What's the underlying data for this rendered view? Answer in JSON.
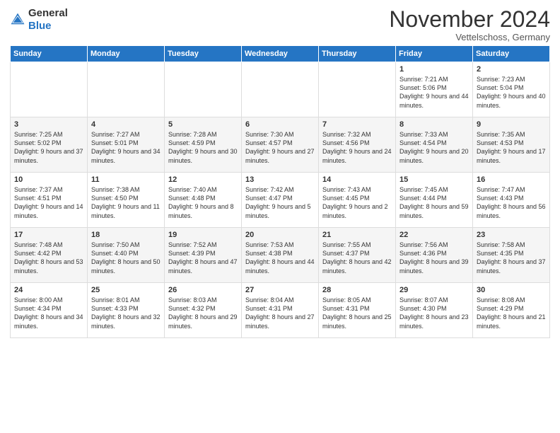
{
  "header": {
    "logo_general": "General",
    "logo_blue": "Blue",
    "month_title": "November 2024",
    "location": "Vettelschoss, Germany"
  },
  "weekdays": [
    "Sunday",
    "Monday",
    "Tuesday",
    "Wednesday",
    "Thursday",
    "Friday",
    "Saturday"
  ],
  "weeks": [
    [
      {
        "num": "",
        "sunrise": "",
        "sunset": "",
        "daylight": ""
      },
      {
        "num": "",
        "sunrise": "",
        "sunset": "",
        "daylight": ""
      },
      {
        "num": "",
        "sunrise": "",
        "sunset": "",
        "daylight": ""
      },
      {
        "num": "",
        "sunrise": "",
        "sunset": "",
        "daylight": ""
      },
      {
        "num": "",
        "sunrise": "",
        "sunset": "",
        "daylight": ""
      },
      {
        "num": "1",
        "sunrise": "Sunrise: 7:21 AM",
        "sunset": "Sunset: 5:06 PM",
        "daylight": "Daylight: 9 hours and 44 minutes."
      },
      {
        "num": "2",
        "sunrise": "Sunrise: 7:23 AM",
        "sunset": "Sunset: 5:04 PM",
        "daylight": "Daylight: 9 hours and 40 minutes."
      }
    ],
    [
      {
        "num": "3",
        "sunrise": "Sunrise: 7:25 AM",
        "sunset": "Sunset: 5:02 PM",
        "daylight": "Daylight: 9 hours and 37 minutes."
      },
      {
        "num": "4",
        "sunrise": "Sunrise: 7:27 AM",
        "sunset": "Sunset: 5:01 PM",
        "daylight": "Daylight: 9 hours and 34 minutes."
      },
      {
        "num": "5",
        "sunrise": "Sunrise: 7:28 AM",
        "sunset": "Sunset: 4:59 PM",
        "daylight": "Daylight: 9 hours and 30 minutes."
      },
      {
        "num": "6",
        "sunrise": "Sunrise: 7:30 AM",
        "sunset": "Sunset: 4:57 PM",
        "daylight": "Daylight: 9 hours and 27 minutes."
      },
      {
        "num": "7",
        "sunrise": "Sunrise: 7:32 AM",
        "sunset": "Sunset: 4:56 PM",
        "daylight": "Daylight: 9 hours and 24 minutes."
      },
      {
        "num": "8",
        "sunrise": "Sunrise: 7:33 AM",
        "sunset": "Sunset: 4:54 PM",
        "daylight": "Daylight: 9 hours and 20 minutes."
      },
      {
        "num": "9",
        "sunrise": "Sunrise: 7:35 AM",
        "sunset": "Sunset: 4:53 PM",
        "daylight": "Daylight: 9 hours and 17 minutes."
      }
    ],
    [
      {
        "num": "10",
        "sunrise": "Sunrise: 7:37 AM",
        "sunset": "Sunset: 4:51 PM",
        "daylight": "Daylight: 9 hours and 14 minutes."
      },
      {
        "num": "11",
        "sunrise": "Sunrise: 7:38 AM",
        "sunset": "Sunset: 4:50 PM",
        "daylight": "Daylight: 9 hours and 11 minutes."
      },
      {
        "num": "12",
        "sunrise": "Sunrise: 7:40 AM",
        "sunset": "Sunset: 4:48 PM",
        "daylight": "Daylight: 9 hours and 8 minutes."
      },
      {
        "num": "13",
        "sunrise": "Sunrise: 7:42 AM",
        "sunset": "Sunset: 4:47 PM",
        "daylight": "Daylight: 9 hours and 5 minutes."
      },
      {
        "num": "14",
        "sunrise": "Sunrise: 7:43 AM",
        "sunset": "Sunset: 4:45 PM",
        "daylight": "Daylight: 9 hours and 2 minutes."
      },
      {
        "num": "15",
        "sunrise": "Sunrise: 7:45 AM",
        "sunset": "Sunset: 4:44 PM",
        "daylight": "Daylight: 8 hours and 59 minutes."
      },
      {
        "num": "16",
        "sunrise": "Sunrise: 7:47 AM",
        "sunset": "Sunset: 4:43 PM",
        "daylight": "Daylight: 8 hours and 56 minutes."
      }
    ],
    [
      {
        "num": "17",
        "sunrise": "Sunrise: 7:48 AM",
        "sunset": "Sunset: 4:42 PM",
        "daylight": "Daylight: 8 hours and 53 minutes."
      },
      {
        "num": "18",
        "sunrise": "Sunrise: 7:50 AM",
        "sunset": "Sunset: 4:40 PM",
        "daylight": "Daylight: 8 hours and 50 minutes."
      },
      {
        "num": "19",
        "sunrise": "Sunrise: 7:52 AM",
        "sunset": "Sunset: 4:39 PM",
        "daylight": "Daylight: 8 hours and 47 minutes."
      },
      {
        "num": "20",
        "sunrise": "Sunrise: 7:53 AM",
        "sunset": "Sunset: 4:38 PM",
        "daylight": "Daylight: 8 hours and 44 minutes."
      },
      {
        "num": "21",
        "sunrise": "Sunrise: 7:55 AM",
        "sunset": "Sunset: 4:37 PM",
        "daylight": "Daylight: 8 hours and 42 minutes."
      },
      {
        "num": "22",
        "sunrise": "Sunrise: 7:56 AM",
        "sunset": "Sunset: 4:36 PM",
        "daylight": "Daylight: 8 hours and 39 minutes."
      },
      {
        "num": "23",
        "sunrise": "Sunrise: 7:58 AM",
        "sunset": "Sunset: 4:35 PM",
        "daylight": "Daylight: 8 hours and 37 minutes."
      }
    ],
    [
      {
        "num": "24",
        "sunrise": "Sunrise: 8:00 AM",
        "sunset": "Sunset: 4:34 PM",
        "daylight": "Daylight: 8 hours and 34 minutes."
      },
      {
        "num": "25",
        "sunrise": "Sunrise: 8:01 AM",
        "sunset": "Sunset: 4:33 PM",
        "daylight": "Daylight: 8 hours and 32 minutes."
      },
      {
        "num": "26",
        "sunrise": "Sunrise: 8:03 AM",
        "sunset": "Sunset: 4:32 PM",
        "daylight": "Daylight: 8 hours and 29 minutes."
      },
      {
        "num": "27",
        "sunrise": "Sunrise: 8:04 AM",
        "sunset": "Sunset: 4:31 PM",
        "daylight": "Daylight: 8 hours and 27 minutes."
      },
      {
        "num": "28",
        "sunrise": "Sunrise: 8:05 AM",
        "sunset": "Sunset: 4:31 PM",
        "daylight": "Daylight: 8 hours and 25 minutes."
      },
      {
        "num": "29",
        "sunrise": "Sunrise: 8:07 AM",
        "sunset": "Sunset: 4:30 PM",
        "daylight": "Daylight: 8 hours and 23 minutes."
      },
      {
        "num": "30",
        "sunrise": "Sunrise: 8:08 AM",
        "sunset": "Sunset: 4:29 PM",
        "daylight": "Daylight: 8 hours and 21 minutes."
      }
    ]
  ]
}
